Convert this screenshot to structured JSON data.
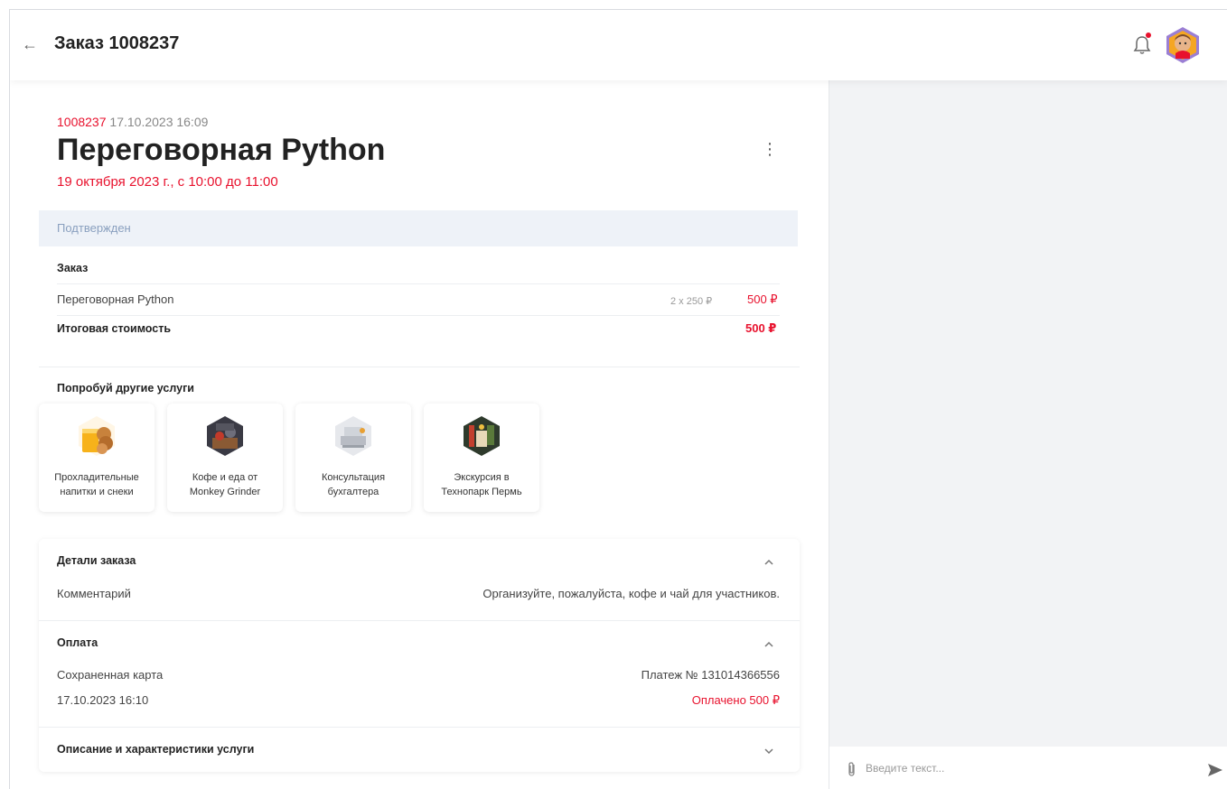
{
  "header": {
    "title": "Заказ 1008237",
    "notification_dot_color": "#e8112d"
  },
  "order": {
    "number": "1008237",
    "created": "17.10.2023 16:09",
    "title": "Переговорная Python",
    "booking_time": "19 октября 2023 г., с 10:00 до 11:00",
    "status": "Подтвержден"
  },
  "order_section": {
    "label": "Заказ",
    "items": [
      {
        "name": "Переговорная Python",
        "qty": "2 x 250 ₽",
        "price": "500 ₽"
      }
    ],
    "total_label": "Итоговая стоимость",
    "total_value": "500 ₽"
  },
  "services": {
    "label": "Попробуй другие услуги",
    "cards": [
      {
        "line1": "Прохладительные",
        "line2": "напитки и снеки"
      },
      {
        "line1": "Кофе и еда от",
        "line2": "Monkey Grinder"
      },
      {
        "line1": "Консультация",
        "line2": "бухгалтера"
      },
      {
        "line1": "Экскурсия в",
        "line2": "Технопарк Пермь"
      }
    ]
  },
  "details": {
    "label": "Детали заказа",
    "comment_label": "Комментарий",
    "comment_value": "Организуйте, пожалуйста, кофе и чай для участников."
  },
  "payment": {
    "label": "Оплата",
    "method": "Сохраненная карта",
    "payment_id": "Платеж № 131014366556",
    "date": "17.10.2023 16:10",
    "status": "Оплачено 500 ₽"
  },
  "description": {
    "label": "Описание и характеристики услуги"
  },
  "chat": {
    "placeholder": "Введите текст..."
  },
  "colors": {
    "accent": "#e8112d",
    "status_bg": "#eef2f8",
    "status_text": "#8aa0bf",
    "chat_bg": "#f2f3f5"
  }
}
